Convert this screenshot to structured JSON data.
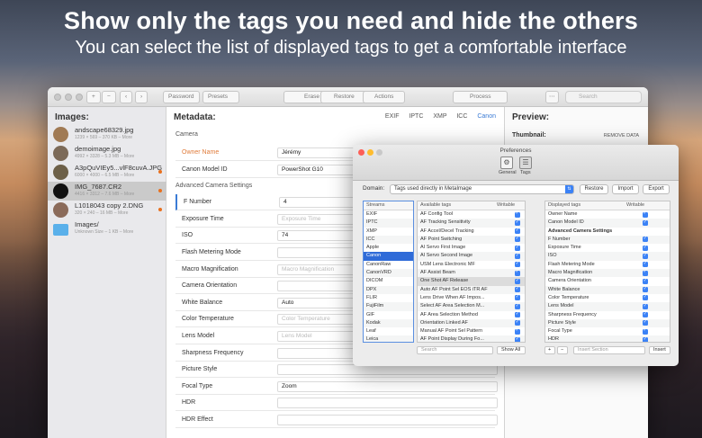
{
  "header": {
    "title": "Show only the tags you need and hide the others",
    "subtitle": "You can select the list of displayed tags to get a comfortable interface"
  },
  "toolbar": {
    "add": "+",
    "remove": "−",
    "back": "‹",
    "forward": "›",
    "password": "Password",
    "presets": "Presets",
    "erase": "Erase",
    "restore": "Restore",
    "actions": "Actions",
    "process": "Process",
    "search_placeholder": "Search"
  },
  "images": {
    "title": "Images:",
    "items": [
      {
        "name": "andscape68329.jpg",
        "meta": "1239 × 569 – 370 KB – More",
        "modified": false,
        "selected": false
      },
      {
        "name": "demoimage.jpg",
        "meta": "4992 × 3328 – 5.3 MB – More",
        "modified": false,
        "selected": false
      },
      {
        "name": "A3pQuVIEy5...vlF8cuvA.JPG",
        "meta": "6000 × 4000 – 6.5 MB – More",
        "modified": true,
        "selected": false
      },
      {
        "name": "IMG_7687.CR2",
        "meta": "4416 × 3312 – 7.6 MB – More",
        "modified": true,
        "selected": true
      },
      {
        "name": "L1018043 copy 2.DNG",
        "meta": "320 × 240 – 16 MB – More",
        "modified": true,
        "selected": false
      },
      {
        "name": "Images/",
        "meta": "Unknown Size – 1 KB – More",
        "modified": false,
        "selected": false
      }
    ]
  },
  "metadata": {
    "title": "Metadata:",
    "formats": [
      "EXIF",
      "IPTC",
      "XMP",
      "ICC",
      "Canon"
    ],
    "sections": [
      {
        "name": "Camera",
        "rows": [
          {
            "label": "Owner Name",
            "value": "Jérémy",
            "placeholder": false
          },
          {
            "label": "Canon Model ID",
            "value": "PowerShot G10",
            "placeholder": false
          }
        ]
      },
      {
        "name": "Advanced Camera Settings",
        "rows": [
          {
            "label": "F Number",
            "value": "4",
            "placeholder": false
          },
          {
            "label": "Exposure Time",
            "value": "Exposure Time",
            "placeholder": true
          },
          {
            "label": "ISO",
            "value": "74",
            "placeholder": false
          },
          {
            "label": "Flash Metering Mode",
            "value": "",
            "placeholder": false
          },
          {
            "label": "Macro Magnification",
            "value": "Macro Magnification",
            "placeholder": true
          },
          {
            "label": "Camera Orientation",
            "value": "",
            "placeholder": false
          },
          {
            "label": "White Balance",
            "value": "Auto",
            "placeholder": false
          },
          {
            "label": "Color Temperature",
            "value": "Color Temperature",
            "placeholder": true
          },
          {
            "label": "Lens Model",
            "value": "Lens Model",
            "placeholder": true
          },
          {
            "label": "Sharpness Frequency",
            "value": "",
            "placeholder": false
          },
          {
            "label": "Picture Style",
            "value": "",
            "placeholder": false
          },
          {
            "label": "Focal Type",
            "value": "Zoom",
            "placeholder": false
          },
          {
            "label": "HDR",
            "value": "",
            "placeholder": false
          },
          {
            "label": "HDR Effect",
            "value": "",
            "placeholder": false
          }
        ]
      }
    ]
  },
  "preview": {
    "title": "Preview:",
    "thumbnail_label": "Thumbnail:",
    "remove_data": "REMOVE DATA"
  },
  "prefs": {
    "title": "Preferences",
    "tabs": [
      "General",
      "Tags"
    ],
    "domain_label": "Domain:",
    "domain_value": "Tags used directly in MetaImage",
    "restore": "Restore",
    "import": "Import",
    "export": "Export",
    "streams_header": "Streams",
    "streams": [
      "EXIF",
      "IPTC",
      "XMP",
      "ICC",
      "Apple",
      "Canon",
      "CanonRaw",
      "CanonVRD",
      "DICOM",
      "DPX",
      "FLIR",
      "FujiFilm",
      "GIF",
      "Kodak",
      "Leaf",
      "Leica",
      "Minolta"
    ],
    "streams_selected": "Canon",
    "available_header": "Available tags",
    "writable_header": "Writable",
    "available": [
      "AF Config Tool",
      "AF Tracking Sensitivity",
      "AF Accel/Decel Tracking",
      "AF Point Switching",
      "AI Servo First Image",
      "AI Servo Second Image",
      "USM Lens Electronic MF",
      "AF Assist Beam",
      "One Shot AF Release",
      "Auto AF Point Sel EOS iTR AF",
      "Lens Drive When AF Impos...",
      "Select AF Area Selection M...",
      "AF Area Selection Method",
      "Orientation Linked AF",
      "Manual AF Point Sel Pattern",
      "AF Point Display During Fo..."
    ],
    "available_highlight": "One Shot AF Release",
    "displayed_header": "Displayed tags",
    "displayed": [
      {
        "label": "Owner Name",
        "bold": false,
        "check": true
      },
      {
        "label": "Canon Model ID",
        "bold": false,
        "check": true
      },
      {
        "label": "Advanced Camera Settings",
        "bold": true,
        "check": false
      },
      {
        "label": "F Number",
        "bold": false,
        "check": true
      },
      {
        "label": "Exposure Time",
        "bold": false,
        "check": true
      },
      {
        "label": "ISO",
        "bold": false,
        "check": true
      },
      {
        "label": "Flash Metering Mode",
        "bold": false,
        "check": true
      },
      {
        "label": "Macro Magnification",
        "bold": false,
        "check": true
      },
      {
        "label": "Camera Orientation",
        "bold": false,
        "check": true
      },
      {
        "label": "White Balance",
        "bold": false,
        "check": true
      },
      {
        "label": "Color Temperature",
        "bold": false,
        "check": true
      },
      {
        "label": "Lens Model",
        "bold": false,
        "check": true
      },
      {
        "label": "Sharpness Frequency",
        "bold": false,
        "check": true
      },
      {
        "label": "Picture Style",
        "bold": false,
        "check": true
      },
      {
        "label": "Focal Type",
        "bold": false,
        "check": true
      },
      {
        "label": "HDR",
        "bold": false,
        "check": true
      }
    ],
    "search_placeholder": "Search",
    "show_all": "Show All",
    "add": "+",
    "remove": "−",
    "insert_placeholder": "Insert Section",
    "insert": "Insert"
  }
}
